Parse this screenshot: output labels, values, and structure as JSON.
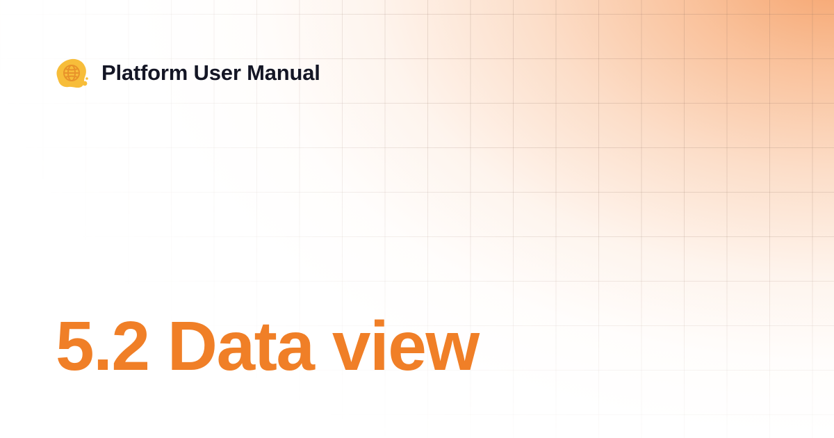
{
  "header": {
    "brand": "Platform User Manual",
    "logo_icon": "globe-blob-icon"
  },
  "main": {
    "title": "5.2 Data view"
  },
  "colors": {
    "title": "#f07f27",
    "brand_text": "#141625",
    "logo_blob": "#f7bd3a",
    "logo_globe": "#e8922a",
    "gradient_accent": "#f6a06a",
    "background": "#ffffff"
  }
}
